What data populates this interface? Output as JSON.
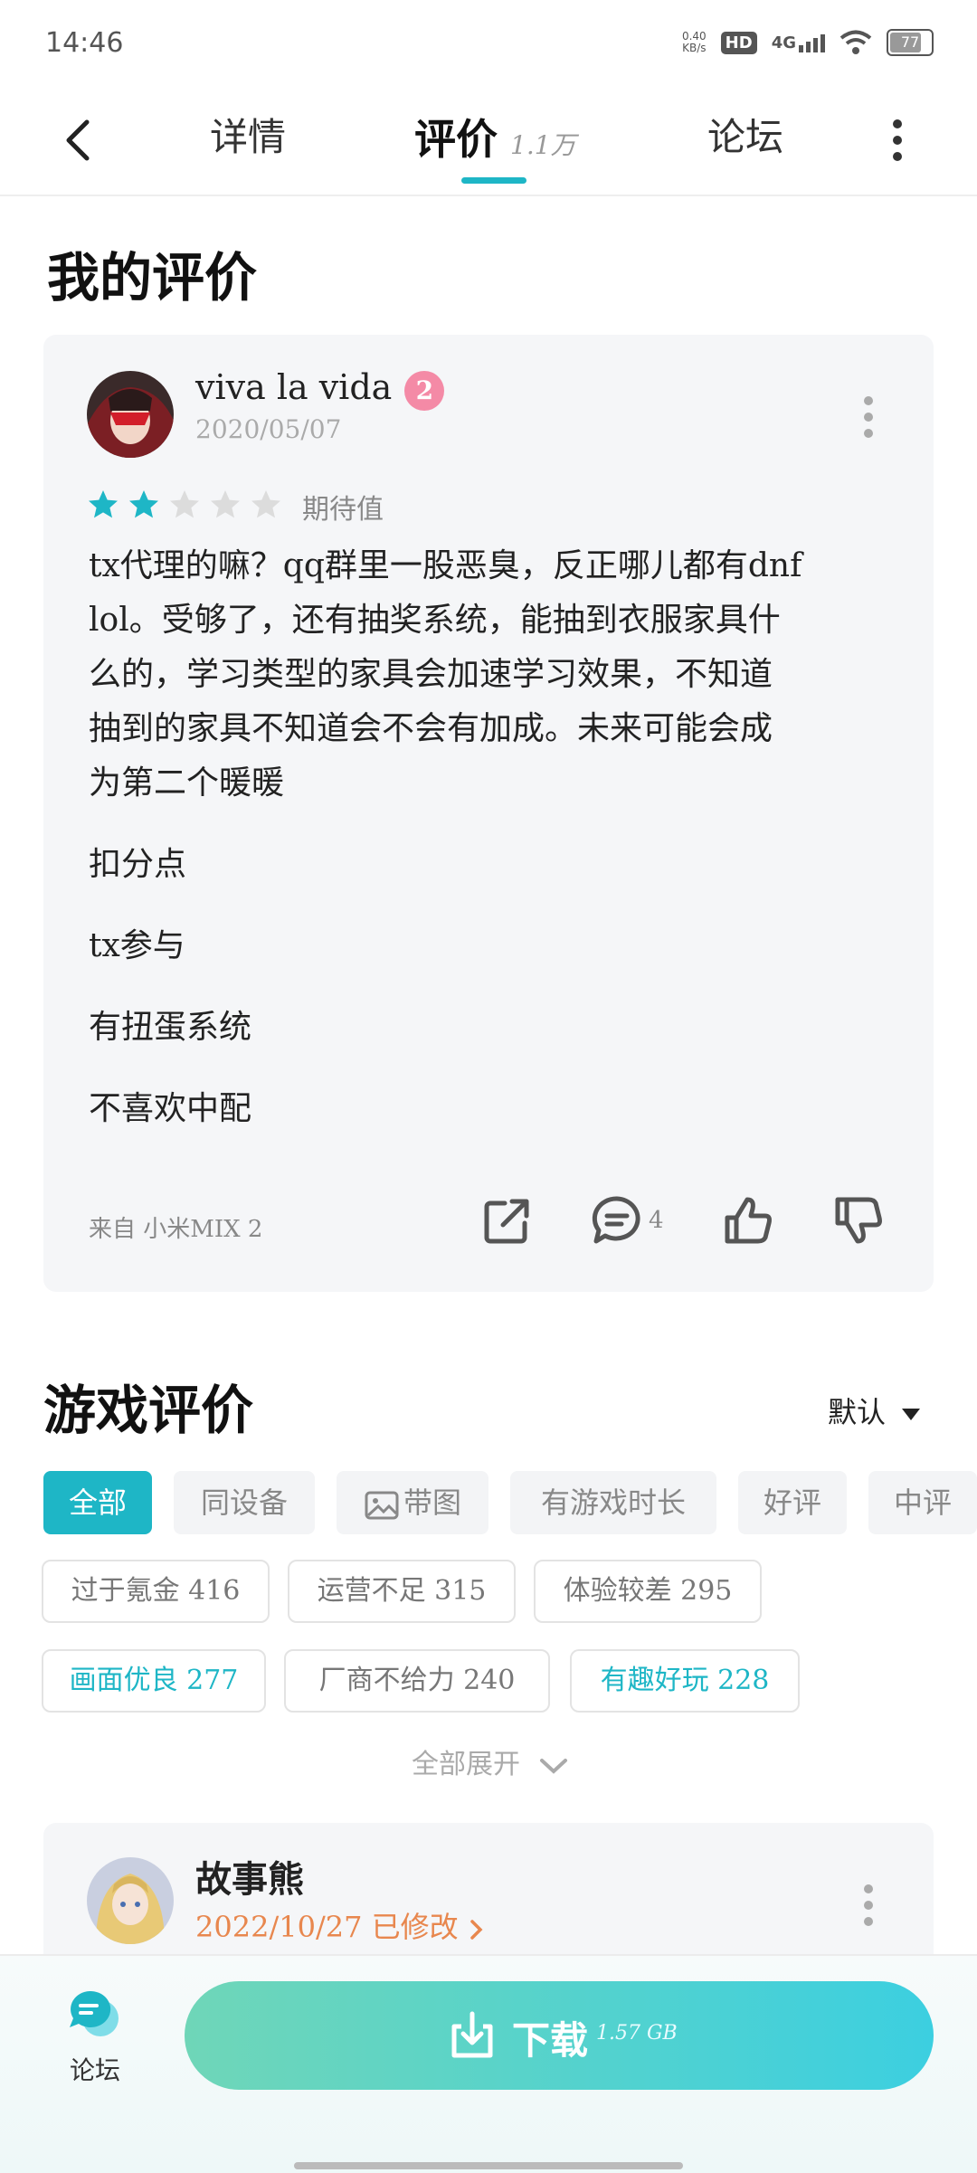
{
  "status_bar": {
    "time": "14:46",
    "speed_value": "0.40",
    "speed_unit": "KB/s",
    "hd": "HD",
    "network": "4G",
    "battery": "77"
  },
  "tabs": {
    "details": "详情",
    "reviews": "评价",
    "reviews_count": "1.1万",
    "forum": "论坛"
  },
  "my_review": {
    "section_title": "我的评价",
    "user": "viva la vida",
    "badge": "2",
    "date": "2020/05/07",
    "rating": 2,
    "rating_max": 5,
    "expect_label": "期待值",
    "body_lines": [
      "tx代理的嘛？qq群里一股恶臭，反正哪儿都有dnf",
      "lol。受够了，还有抽奖系统，能抽到衣服家具什",
      "么的，学习类型的家具会加速学习效果，不知道",
      "抽到的家具不知道会不会有加成。未来可能会成",
      "为第二个暖暖"
    ],
    "points": [
      "扣分点",
      "tx参与",
      "有扭蛋系统",
      "不喜欢中配"
    ],
    "device": "来自 小米MIX 2",
    "comment_count": "4"
  },
  "game_reviews": {
    "section_title": "游戏评价",
    "sort_label": "默认",
    "filters": [
      "全部",
      "同设备",
      "带图",
      "有游戏时长",
      "好评",
      "中评"
    ],
    "tags": [
      "过于氪金 416",
      "运营不足 315",
      "体验较差 295",
      "画面优良 277",
      "厂商不给力 240",
      "有趣好玩 228"
    ],
    "expand_label": "全部展开",
    "first_review": {
      "user": "故事熊",
      "date_text": "2022/10/27 已修改"
    }
  },
  "bottom": {
    "forum_label": "论坛",
    "download_label": "下载",
    "download_size": "1.57 GB"
  },
  "colors": {
    "accent": "#1eb6c6",
    "orange": "#e8874e",
    "badge_pink": "#f48aa6"
  }
}
